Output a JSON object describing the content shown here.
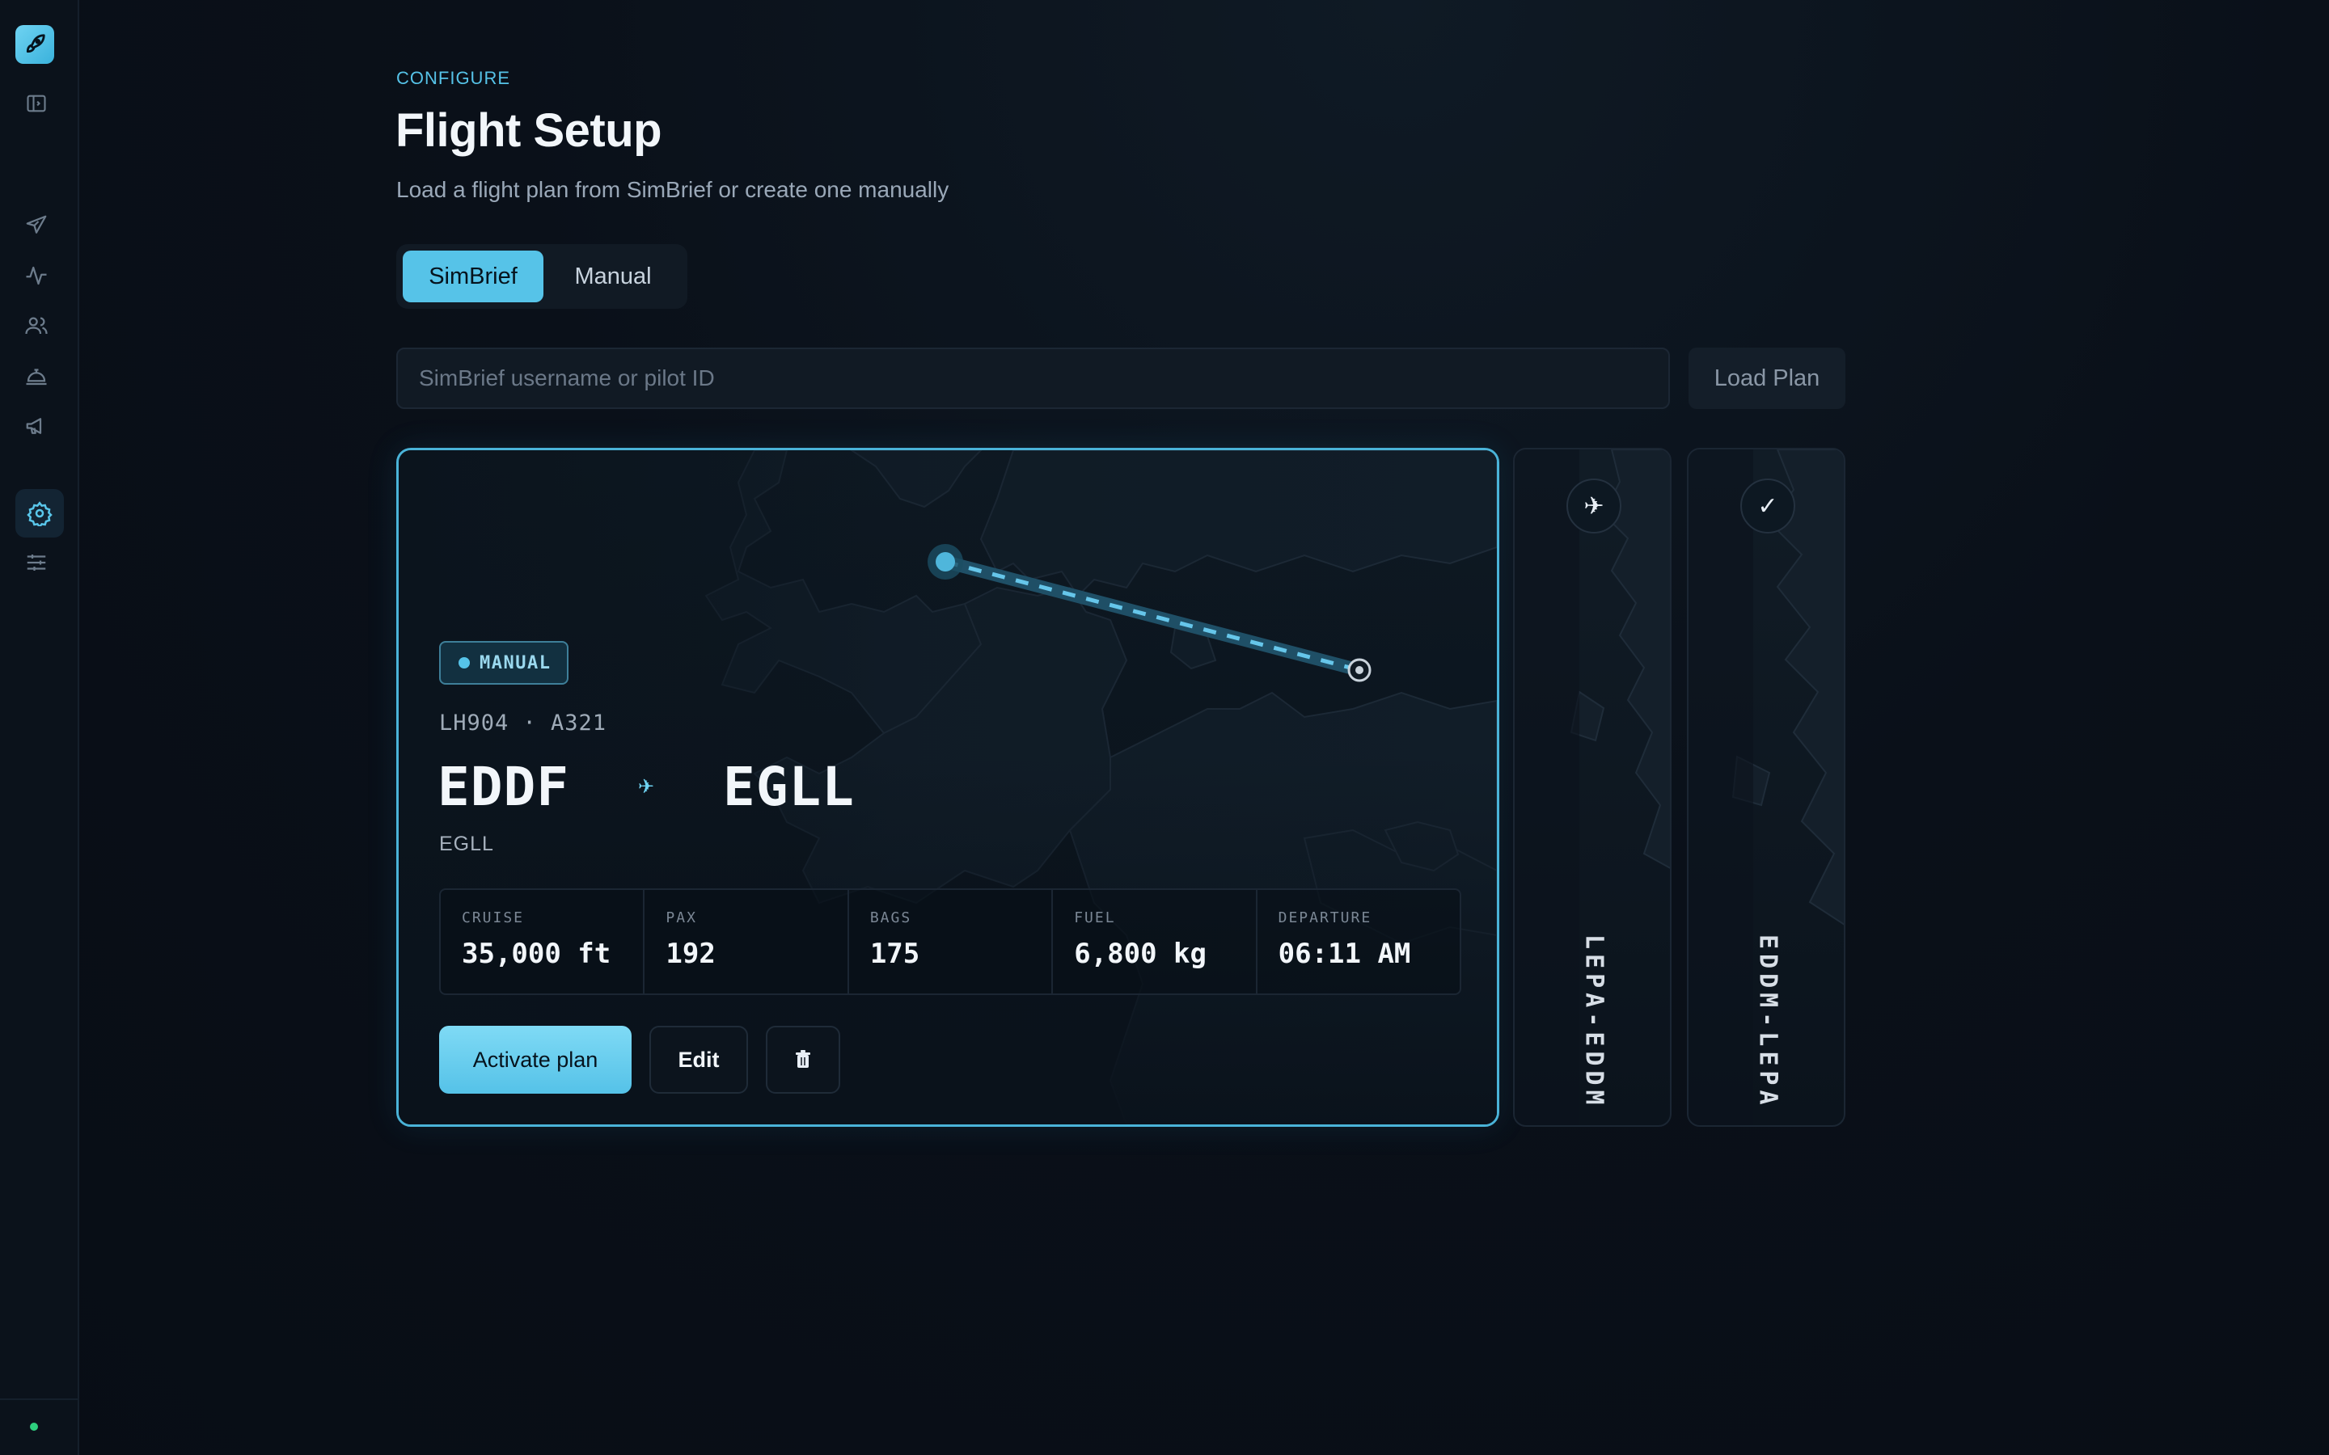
{
  "header": {
    "eyebrow": "CONFIGURE",
    "title": "Flight Setup",
    "subtitle": "Load a flight plan from SimBrief or create one manually"
  },
  "mode_tabs": [
    {
      "label": "SimBrief",
      "active": true
    },
    {
      "label": "Manual",
      "active": false
    }
  ],
  "simbrief": {
    "placeholder": "SimBrief username or pilot ID",
    "load_button": "Load Plan"
  },
  "active_plan": {
    "badge": "MANUAL",
    "flight_meta": "LH904 · A321",
    "origin": "EDDF",
    "destination": "EGLL",
    "destination_small": "EGLL",
    "stats": [
      {
        "label": "CRUISE",
        "value": "35,000 ft"
      },
      {
        "label": "PAX",
        "value": "192"
      },
      {
        "label": "BAGS",
        "value": "175"
      },
      {
        "label": "FUEL",
        "value": "6,800 kg"
      },
      {
        "label": "DEPARTURE",
        "value": "06:11 AM"
      }
    ],
    "actions": {
      "activate": "Activate plan",
      "edit": "Edit",
      "delete_icon": "trash-icon"
    }
  },
  "other_plans": [
    {
      "route": "LEPA-EDDM",
      "icon": "airplane-icon",
      "glyph": "✈"
    },
    {
      "route": "EDDM-LEPA",
      "icon": "check-icon",
      "glyph": "✓"
    }
  ],
  "sidebar": {
    "icons": [
      "logo-rocket-icon",
      "sidebar-toggle-icon",
      "flight-icon",
      "activity-icon",
      "users-icon",
      "service-bell-icon",
      "megaphone-icon",
      "settings-icon",
      "sliders-icon"
    ],
    "active": "settings-icon",
    "status": "online"
  },
  "colors": {
    "accent": "#56c3e8",
    "background": "#0a1019",
    "status_online": "#2ecf7e"
  }
}
